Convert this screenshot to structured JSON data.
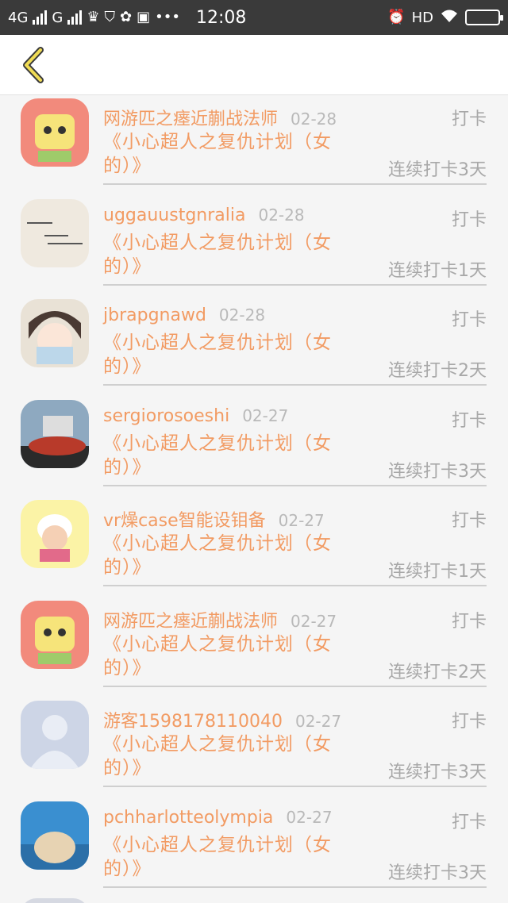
{
  "statusbar": {
    "network_1": "4G",
    "network_2": "G",
    "time": "12:08",
    "hd": "HD",
    "icons": [
      "crown-icon",
      "shield-icon",
      "palette-icon",
      "app-icon",
      "more-icon",
      "alarm-icon",
      "wifi-icon",
      "battery-icon"
    ]
  },
  "header": {
    "back_icon": "chevron-left-icon"
  },
  "items": [
    {
      "name": "网游匹之瘗近蒯战法师",
      "date": "02-28",
      "action": "打卡",
      "title": "《小心超人之复仇计划（女的）》",
      "streak": "连续打卡3天"
    },
    {
      "name": "uggauustgnralia",
      "date": "02-28",
      "action": "打卡",
      "title": "《小心超人之复仇计划（女的）》",
      "streak": "连续打卡1天"
    },
    {
      "name": "jbrapgnawd",
      "date": "02-28",
      "action": "打卡",
      "title": "《小心超人之复仇计划（女的）》",
      "streak": "连续打卡2天"
    },
    {
      "name": "sergiorosoeshi",
      "date": "02-27",
      "action": "打卡",
      "title": "《小心超人之复仇计划（女的）》",
      "streak": "连续打卡3天"
    },
    {
      "name": "vr燥case智能设钼备",
      "date": "02-27",
      "action": "打卡",
      "title": "《小心超人之复仇计划（女的）》",
      "streak": "连续打卡1天"
    },
    {
      "name": "网游匹之瘗近蒯战法师",
      "date": "02-27",
      "action": "打卡",
      "title": "《小心超人之复仇计划（女的）》",
      "streak": "连续打卡2天"
    },
    {
      "name": "游客1598178110040",
      "date": "02-27",
      "action": "打卡",
      "title": "《小心超人之复仇计划（女的）》",
      "streak": "连续打卡3天"
    },
    {
      "name": "pchharlotteolympia",
      "date": "02-27",
      "action": "打卡",
      "title": "《小心超人之复仇计划（女的）》",
      "streak": "连续打卡3天"
    }
  ],
  "colors": {
    "accent": "#f29b63",
    "muted": "#a8a8a8",
    "date": "#b9b9b9"
  }
}
